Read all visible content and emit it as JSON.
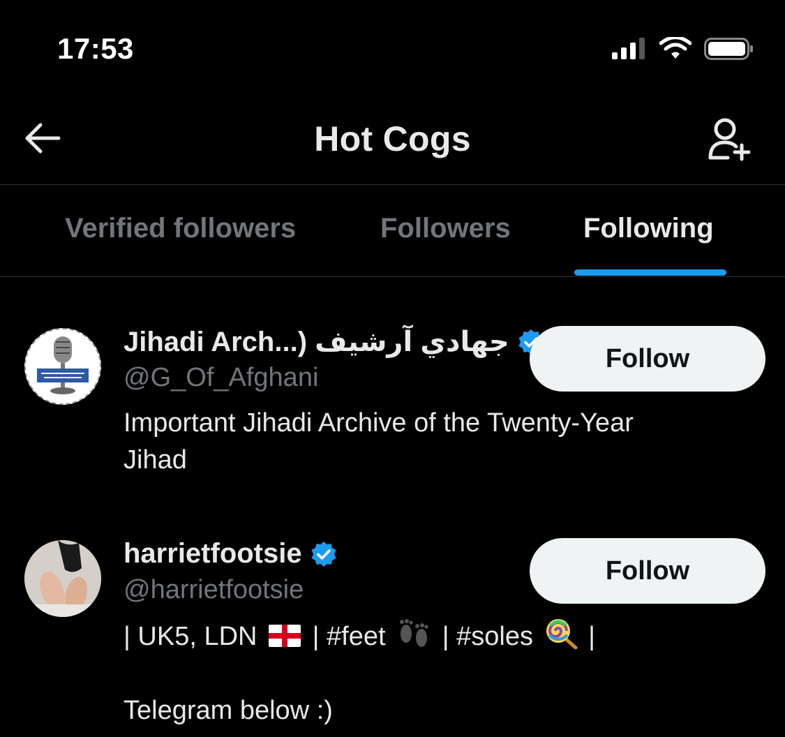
{
  "status_bar": {
    "time": "17:53",
    "icons": [
      "signal-icon",
      "wifi-icon",
      "battery-icon"
    ]
  },
  "header": {
    "title": "Hot Cogs",
    "back_icon": "arrow-left-icon",
    "add_icon": "add-user-icon"
  },
  "tabs": [
    {
      "label": "Verified followers",
      "active": false
    },
    {
      "label": "Followers",
      "active": false
    },
    {
      "label": "Following",
      "active": true
    }
  ],
  "users": [
    {
      "name": "Jihadi Arch...) جهادي آرشيف",
      "verified": true,
      "handle": "@G_Of_Afghani",
      "bio_line1": "Important Jihadi Archive of the Twenty-Year",
      "bio_line2": "Jihad",
      "follow_label": "Follow"
    },
    {
      "name": "harrietfootsie",
      "verified": true,
      "handle": "@harrietfootsie",
      "bio_part1": "| UK5, LDN",
      "bio_part2": "| #feet",
      "bio_part3": "| #soles",
      "bio_part4": "|",
      "bio_line3": "Telegram below :)",
      "follow_label": "Follow"
    }
  ],
  "colors": {
    "background": "#000000",
    "accent": "#1d9bf0",
    "text_primary": "#e7e9ea",
    "text_secondary": "#71767b",
    "button_bg": "#eff3f4"
  }
}
